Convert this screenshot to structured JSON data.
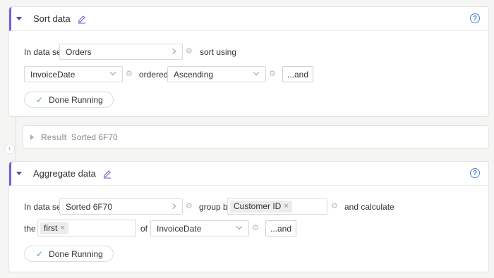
{
  "sort_step": {
    "title": "Sort data",
    "help": "?",
    "in_data_set_label": "In data set",
    "data_set_value": "Orders",
    "sort_using_label": "sort using",
    "sort_field_value": "InvoiceDate",
    "ordered_label": "ordered",
    "order_value": "Ascending",
    "and_label": "...and",
    "done_label": "Done Running"
  },
  "result": {
    "label": "Result",
    "value": "Sorted 6F70"
  },
  "aggregate_step": {
    "title": "Aggregate data",
    "help": "?",
    "in_data_set_label": "In data set",
    "data_set_value": "Sorted 6F70",
    "group_by_label": "group by",
    "group_by_tag": "Customer ID",
    "and_calculate_label": "and calculate",
    "the_label": "the",
    "function_tag": "first",
    "of_label": "of",
    "of_field_value": "InvoiceDate",
    "and_label": "...and",
    "done_label": "Done Running"
  },
  "icons": {
    "add": "+",
    "tag_remove": "×",
    "check": "✓",
    "gear": "⚙"
  },
  "colors": {
    "accent": "#6c63d7",
    "help": "#4a7fd6",
    "done_check": "#4fae5b"
  }
}
